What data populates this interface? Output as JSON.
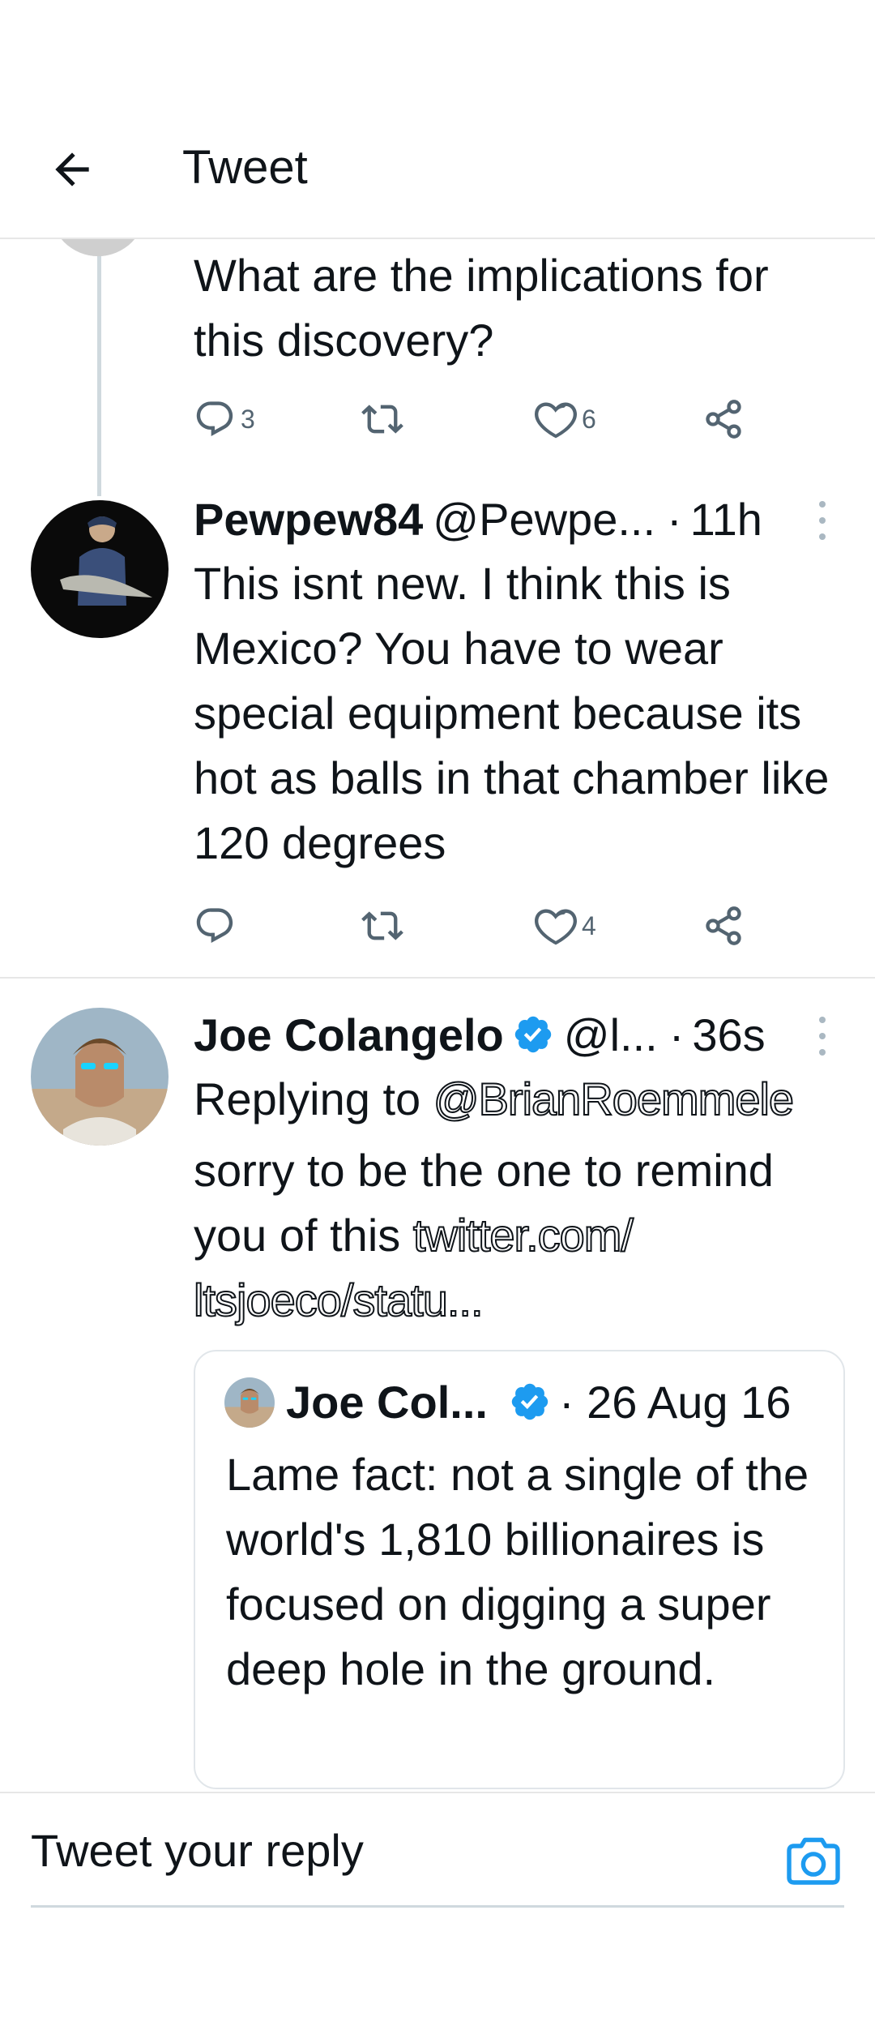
{
  "header": {
    "title": "Tweet"
  },
  "thread_parent": {
    "text": "What are the implications for this discovery?",
    "replies": "3",
    "likes": "6"
  },
  "reply1": {
    "name": "Pewpew84",
    "handle": "@Pewpe...",
    "dot": "·",
    "time": "11h",
    "text": "This isnt new. I think this is Mexico? You have to wear special equipment because its hot as balls in that chamber like 120 degrees",
    "likes": "4"
  },
  "reply2": {
    "name": "Joe Colangelo",
    "handle": "@l...",
    "dot": "·",
    "time": "36s",
    "replying_prefix": "Replying to ",
    "replying_to": "@BrianRoemmele",
    "text_lead": "sorry to be the one to remind you of this ",
    "link": "twitter.com/ ltsjoeco/statu...",
    "quote": {
      "name": "Joe Col...",
      "date": "· 26 Aug 16",
      "text": "Lame fact: not a single of the world's 1,810 billionaires is focused on digging a super deep hole in the ground."
    }
  },
  "composer": {
    "placeholder": "Tweet your reply"
  },
  "colors": {
    "accent": "#1d9bf0",
    "icon_gray": "#536471",
    "divider": "#e7e7e7"
  },
  "icons": [
    "back-arrow-icon",
    "reply-icon",
    "retweet-icon",
    "like-icon",
    "share-icon",
    "verified-badge-icon",
    "more-icon",
    "camera-icon"
  ]
}
